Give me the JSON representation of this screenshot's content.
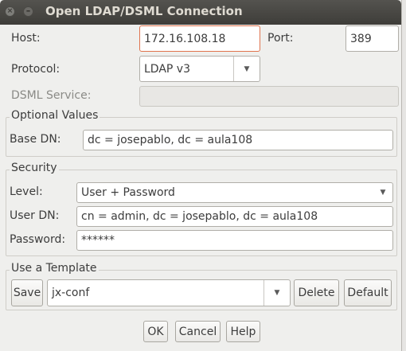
{
  "window": {
    "title": "Open LDAP/DSML Connection"
  },
  "connection": {
    "host_label": "Host:",
    "host_value": "172.16.108.18",
    "port_label": "Port:",
    "port_value": "389",
    "protocol_label": "Protocol:",
    "protocol_value": "LDAP v3",
    "dsml_label": "DSML Service:",
    "dsml_value": ""
  },
  "optional": {
    "title": "Optional Values",
    "base_dn_label": "Base DN:",
    "base_dn_value": "dc = josepablo, dc = aula108"
  },
  "security": {
    "title": "Security",
    "level_label": "Level:",
    "level_value": "User + Password",
    "user_dn_label": "User DN:",
    "user_dn_value": "cn = admin, dc = josepablo, dc = aula108",
    "password_label": "Password:",
    "password_value": "******"
  },
  "template": {
    "title": "Use a Template",
    "save_label": "Save",
    "selected": "jx-conf",
    "delete_label": "Delete",
    "default_label": "Default"
  },
  "footer": {
    "ok_label": "OK",
    "cancel_label": "Cancel",
    "help_label": "Help"
  },
  "icons": {
    "close": "close-icon",
    "minimize": "minimize-icon",
    "dropdown": "chevron-down-icon"
  }
}
